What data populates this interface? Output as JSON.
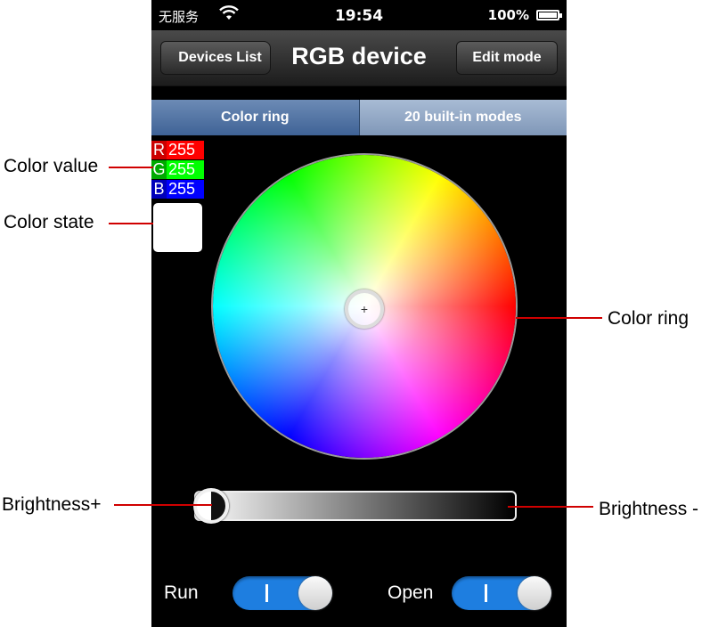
{
  "status_bar": {
    "carrier": "无服务",
    "time": "19:54",
    "battery": "100%"
  },
  "nav": {
    "back_label": "Devices List",
    "title": "RGB device",
    "edit_label": "Edit mode"
  },
  "segments": [
    {
      "label": "Color ring",
      "active": true
    },
    {
      "label": "20 built-in modes",
      "active": false
    }
  ],
  "color_value": {
    "r_label": "R",
    "r": "255",
    "g_label": "G",
    "g": "255",
    "b_label": "B",
    "b": "255"
  },
  "color_state_hex": "#ffffff",
  "picker_symbol": "+",
  "brightness_level": 1.0,
  "switches": [
    {
      "label": "Run",
      "on": true
    },
    {
      "label": "Open",
      "on": true
    }
  ],
  "annotations": {
    "color_value": "Color value",
    "color_state": "Color state",
    "color_ring": "Color ring",
    "brightness_plus": "Brightness+",
    "brightness_minus": "Brightness -"
  },
  "colors": {
    "r_bg": "#ff0000",
    "g_bg": "#00ff00",
    "b_bg": "#0000ff",
    "r_lbl_bg": "#cc0000",
    "g_lbl_bg": "#00aa00",
    "b_lbl_bg": "#0000bb",
    "accent": "#1e7ee0",
    "annotation_line": "#d00000"
  }
}
